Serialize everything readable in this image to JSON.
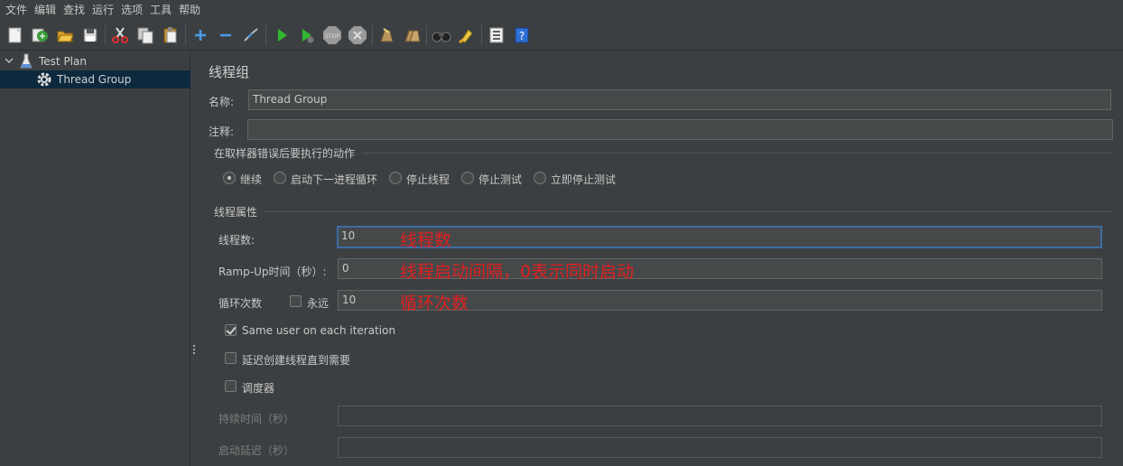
{
  "menu": [
    "文件",
    "编辑",
    "查找",
    "运行",
    "选项",
    "工具",
    "帮助"
  ],
  "toolbar_icons": [
    "new-icon",
    "templates-icon",
    "open-icon",
    "save-icon",
    "cut-icon",
    "copy-icon",
    "paste-icon",
    "expand-icon",
    "collapse-icon",
    "toggle-icon",
    "start-icon",
    "start-no-timers-icon",
    "stop-icon",
    "shutdown-icon",
    "clear-icon",
    "clear-all-icon",
    "search-icon",
    "reset-search-icon",
    "function-helper-icon",
    "help-icon"
  ],
  "tree": {
    "root": "Test Plan",
    "child": "Thread Group"
  },
  "panel": {
    "title": "线程组",
    "name_label": "名称:",
    "name_value": "Thread Group",
    "comment_label": "注释:",
    "comment_value": "",
    "error_group_label": "在取样器错误后要执行的动作",
    "error_actions": [
      "继续",
      "启动下一进程循环",
      "停止线程",
      "停止测试",
      "立即停止测试"
    ],
    "error_selected": "继续",
    "props_group_label": "线程属性",
    "threads_label": "线程数:",
    "threads_value": "10",
    "rampup_label": "Ramp-Up时间（秒）:",
    "rampup_value": "0",
    "loop_label": "循环次数",
    "forever_label": "永远",
    "forever_checked": false,
    "loop_value": "10",
    "same_user_label": "Same user on each iteration",
    "same_user_checked": true,
    "delay_label": "延迟创建线程直到需要",
    "delay_checked": false,
    "scheduler_label": "调度器",
    "scheduler_checked": false,
    "duration_label": "持续时间（秒）",
    "duration_value": "",
    "startup_delay_label": "启动延迟（秒）",
    "startup_delay_value": ""
  },
  "annotations": {
    "threads_note": "线程数",
    "rampup_note": "线程启动间隔，0表示同时启动",
    "loop_note": "循环次数"
  },
  "colors": {
    "background": "#3c3f41",
    "selection": "#0d293e",
    "annotation": "#e02020",
    "focus_border": "#3d6ca3"
  }
}
